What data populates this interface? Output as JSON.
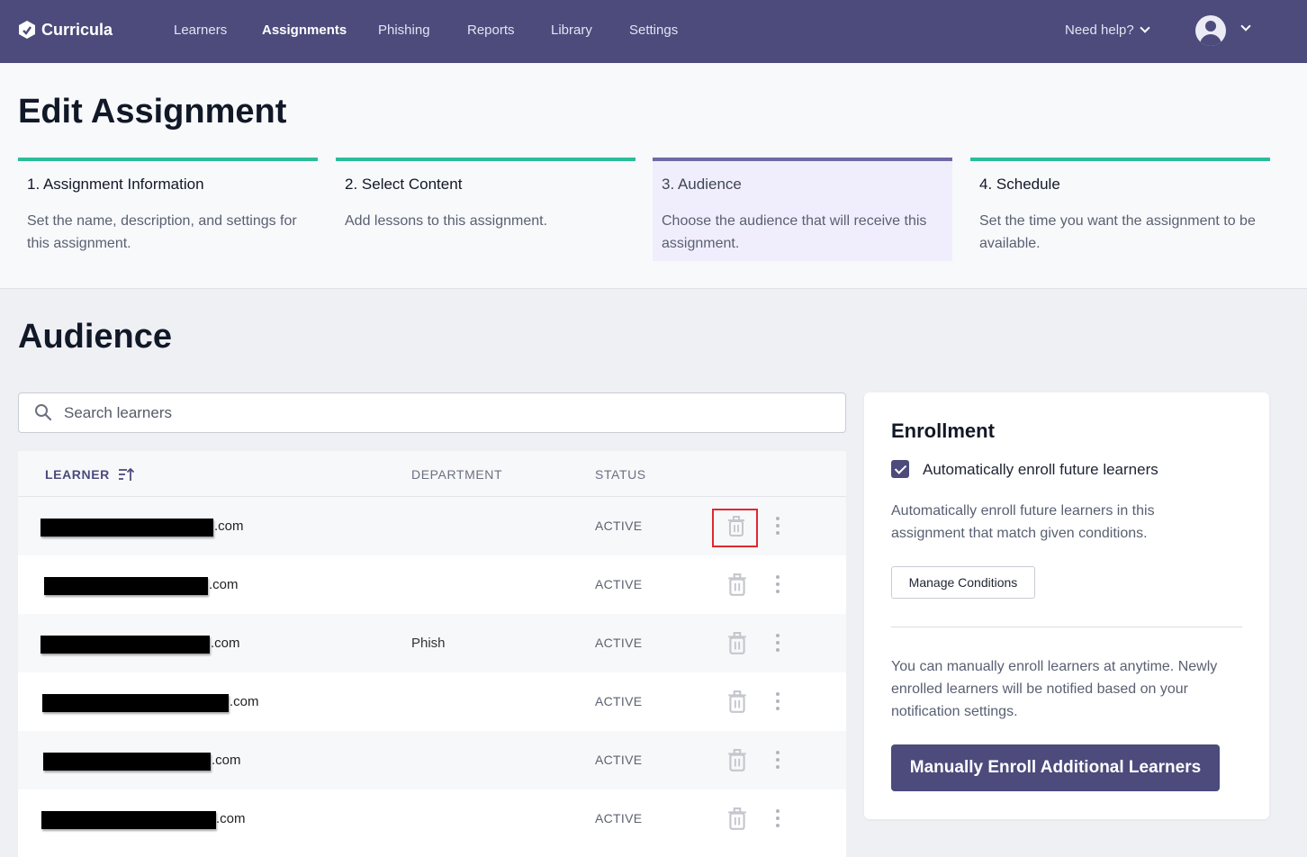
{
  "nav": {
    "brand": "Curricula",
    "items": [
      {
        "label": "Learners",
        "active": false
      },
      {
        "label": "Assignments",
        "active": true
      },
      {
        "label": "Phishing",
        "active": false
      },
      {
        "label": "Reports",
        "active": false
      },
      {
        "label": "Library",
        "active": false
      },
      {
        "label": "Settings",
        "active": false
      }
    ],
    "help": "Need help?"
  },
  "header": {
    "title": "Edit Assignment",
    "steps": [
      {
        "title": "1. Assignment Information",
        "desc": "Set the name, description, and settings for this assignment.",
        "state": "complete"
      },
      {
        "title": "2. Select Content",
        "desc": "Add lessons to this assignment.",
        "state": "complete"
      },
      {
        "title": "3. Audience",
        "desc": "Choose the audience that will receive this assignment.",
        "state": "current"
      },
      {
        "title": "4. Schedule",
        "desc": "Set the time you want the assignment to be available.",
        "state": "upcoming"
      }
    ]
  },
  "audience": {
    "title": "Audience",
    "search": {
      "placeholder": "Search learners",
      "value": ""
    },
    "columns": {
      "learner": "LEARNER",
      "department": "DEPARTMENT",
      "status": "STATUS"
    },
    "rows": [
      {
        "email_suffix": ".com",
        "department": "",
        "status": "ACTIVE"
      },
      {
        "email_suffix": ".com",
        "department": "",
        "status": "ACTIVE"
      },
      {
        "email_suffix": ".com",
        "department": "Phish",
        "status": "ACTIVE"
      },
      {
        "email_suffix": ".com",
        "department": "",
        "status": "ACTIVE"
      },
      {
        "email_suffix": ".com",
        "department": "",
        "status": "ACTIVE"
      },
      {
        "email_suffix": ".com",
        "department": "",
        "status": "ACTIVE"
      }
    ]
  },
  "enrollment": {
    "title": "Enrollment",
    "auto_enroll_label": "Automatically enroll future learners",
    "auto_enroll_checked": true,
    "auto_enroll_desc": "Automatically enroll future learners in this assignment that match given conditions.",
    "manage_conditions": "Manage Conditions",
    "manual_desc": "You can manually enroll learners at anytime. Newly enrolled learners will be notified based on your notification settings.",
    "manual_button": "Manually Enroll Additional Learners"
  },
  "colors": {
    "nav_bg": "#4c4b7c",
    "step_complete": "#2bbd9b",
    "step_current": "#6d6aa5",
    "highlight": "#e0282e"
  }
}
